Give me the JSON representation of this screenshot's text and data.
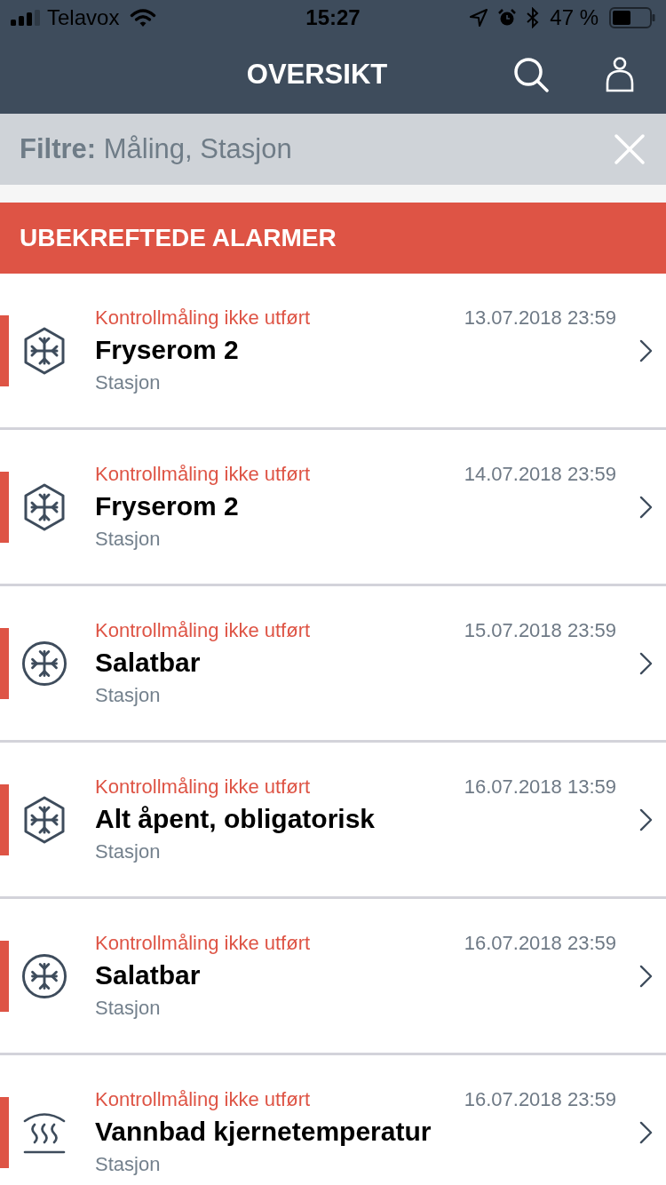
{
  "status_bar": {
    "carrier": "Telavox",
    "time": "15:27",
    "battery": "47 %"
  },
  "nav": {
    "title": "OVERSIKT"
  },
  "filter": {
    "text": "**Filtre:** Måling, Stasjon"
  },
  "section": {
    "title": "UBEKREFTEDE ALARMER"
  },
  "alarms": [
    {
      "kind": "hexagon",
      "alert": "Kontrollmåling ikke utført",
      "time": "13.07.2018 23:59",
      "name": "Fryserom 2",
      "type": "Stasjon"
    },
    {
      "kind": "hexagon",
      "alert": "Kontrollmåling ikke utført",
      "time": "14.07.2018 23:59",
      "name": "Fryserom 2",
      "type": "Stasjon"
    },
    {
      "kind": "circle",
      "alert": "Kontrollmåling ikke utført",
      "time": "15.07.2018 23:59",
      "name": "Salatbar",
      "type": "Stasjon"
    },
    {
      "kind": "hexagon",
      "alert": "Kontrollmåling ikke utført",
      "time": "16.07.2018 13:59",
      "name": "Alt åpent, obligatorisk",
      "type": "Stasjon"
    },
    {
      "kind": "circle",
      "alert": "Kontrollmåling ikke utført",
      "time": "16.07.2018 23:59",
      "name": "Salatbar",
      "type": "Stasjon"
    },
    {
      "kind": "steam",
      "alert": "Kontrollmåling ikke utført",
      "time": "16.07.2018 23:59",
      "name": "Vannbad kjernetemperatur",
      "type": "Stasjon"
    }
  ]
}
